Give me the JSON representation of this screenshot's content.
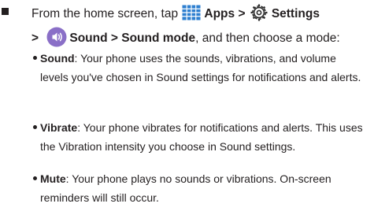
{
  "instruction": {
    "prefix": "From the home screen, tap ",
    "apps_label": "Apps",
    "separator_1": " > ",
    "settings_label": "Settings",
    "separator_2": "> ",
    "sound_label": "Sound",
    "separator_3": " > ",
    "sound_mode_label": "Sound mode",
    "suffix": ", and then choose a mode:"
  },
  "icons": {
    "apps": "apps-grid-icon",
    "settings": "gear-icon",
    "sound": "speaker-icon",
    "apps_color": "#2e7fd0",
    "settings_color": "#2a2a2a",
    "sound_color": "#8a6fc7"
  },
  "modes": [
    {
      "name": "Sound",
      "description": ": Your phone uses the sounds, vibrations, and volume levels you've chosen in Sound settings for notifications and alerts."
    },
    {
      "name": "Vibrate",
      "description": ": Your phone vibrates for notifications and alerts. This uses the Vibration intensity you choose in Sound settings."
    },
    {
      "name": "Mute",
      "description": ": Your phone plays no sounds or vibrations. On-screen reminders will still occur."
    }
  ]
}
